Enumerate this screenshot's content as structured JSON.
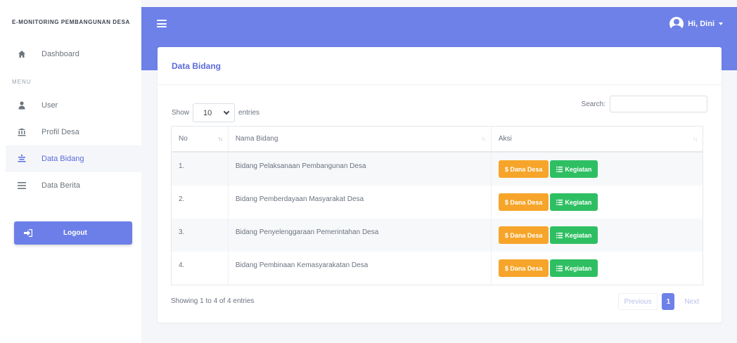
{
  "app": {
    "brand": "E-MONITORING PEMBANGUNAN DESA"
  },
  "sidebar": {
    "items": [
      {
        "label": "Dashboard",
        "icon": "home-icon"
      },
      {
        "label": "User",
        "icon": "user-icon"
      },
      {
        "label": "Profil Desa",
        "icon": "bank-icon"
      },
      {
        "label": "Data Bidang",
        "icon": "list-icon",
        "active": true
      },
      {
        "label": "Data Berita",
        "icon": "bars-icon"
      }
    ],
    "section_label": "MENU",
    "logout_label": "Logout"
  },
  "topbar": {
    "user_greeting": "Hi, Dini"
  },
  "card": {
    "title": "Data Bidang"
  },
  "table_controls": {
    "show_label": "Show",
    "entries_value": "10",
    "entries_label": "entries",
    "search_label": "Search:",
    "search_value": ""
  },
  "table": {
    "columns": [
      "No",
      "Nama Bidang",
      "Aksi"
    ],
    "rows": [
      {
        "no": "1.",
        "name": "Bidang Pelaksanaan Pembangunan Desa"
      },
      {
        "no": "2.",
        "name": "Bidang Pemberdayaan Masyarakat Desa"
      },
      {
        "no": "3.",
        "name": "Bidang Penyelenggaraan Pemerintahan Desa"
      },
      {
        "no": "4.",
        "name": "Bidang Pembinaan Kemasyarakatan Desa"
      }
    ],
    "action_dana": "$ Dana Desa",
    "action_kegiatan": "Kegiatan"
  },
  "footer": {
    "info": "Showing 1 to 4 of 4 entries",
    "previous": "Previous",
    "current_page": "1",
    "next": "Next"
  },
  "colors": {
    "accent": "#6d81e8",
    "warning": "#f6a52a",
    "success": "#2fbf63"
  }
}
